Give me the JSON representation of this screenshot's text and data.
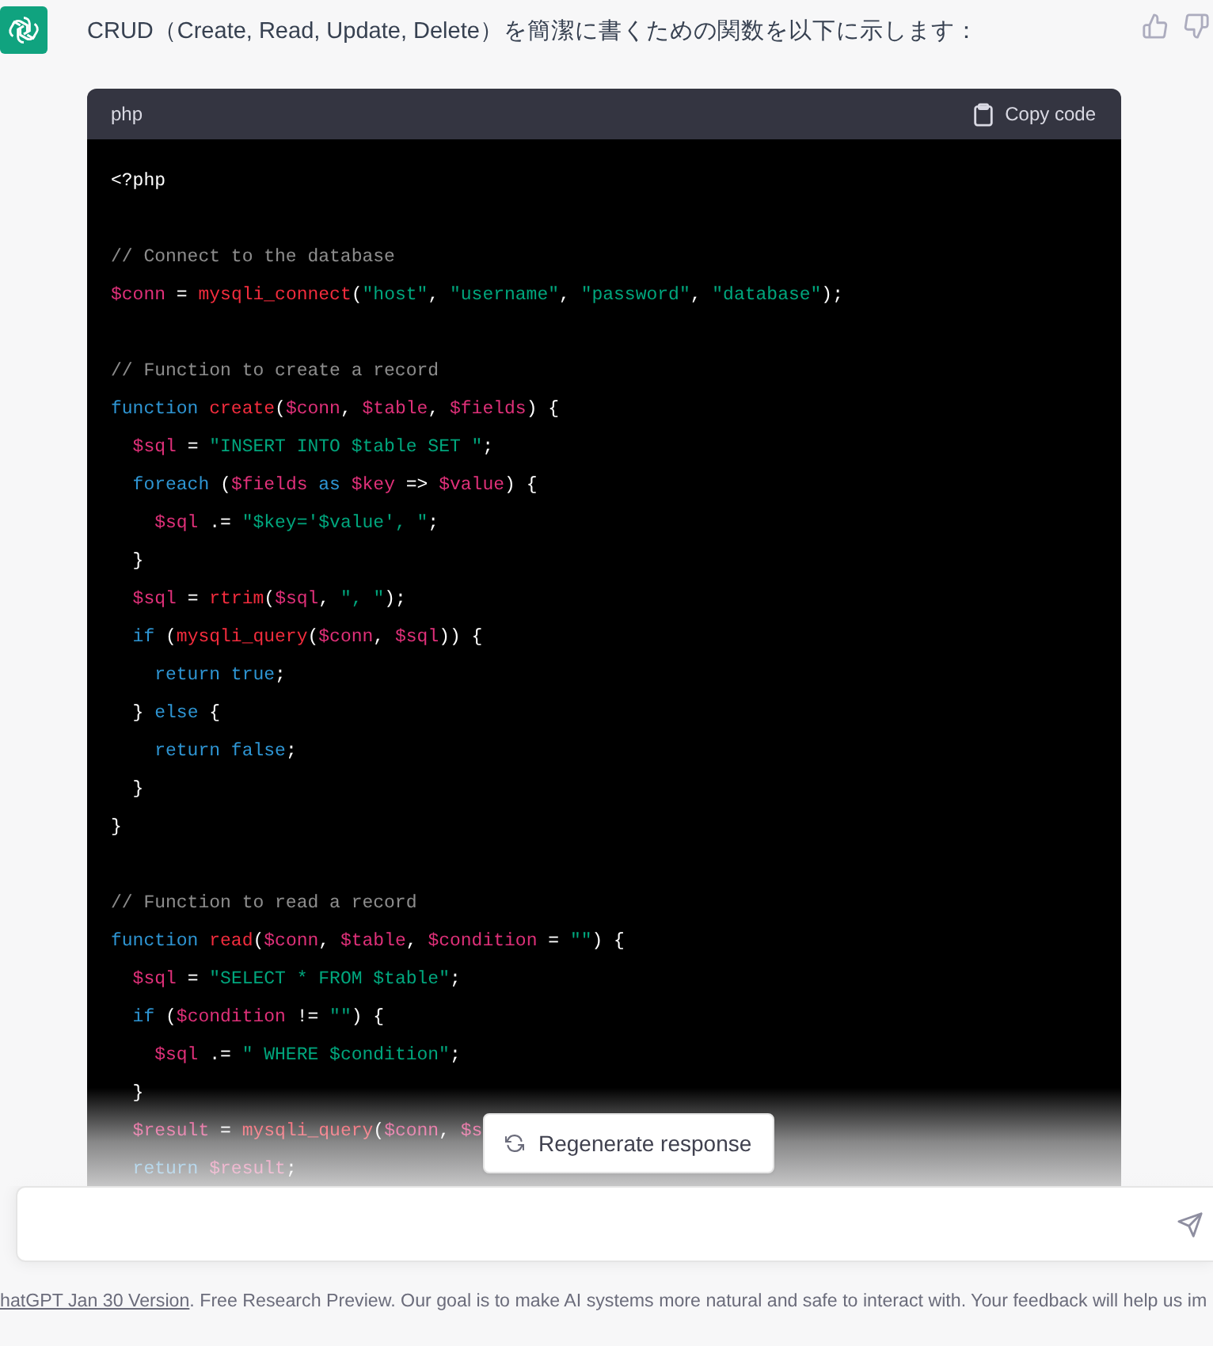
{
  "message": {
    "text": "CRUD（Create, Read, Update, Delete）を簡潔に書くための関数を以下に示します："
  },
  "code_block": {
    "language": "php",
    "copy_label": "Copy code",
    "lines": [
      {
        "kind": "code",
        "tokens": [
          {
            "kind": "plain",
            "text": "<?php"
          }
        ]
      },
      {
        "kind": "blank"
      },
      {
        "kind": "code",
        "tokens": [
          {
            "kind": "comment",
            "text": "// Connect to the database"
          }
        ]
      },
      {
        "kind": "code",
        "tokens": [
          {
            "kind": "var",
            "text": "$conn"
          },
          {
            "kind": "plain",
            "text": " = "
          },
          {
            "kind": "func",
            "text": "mysqli_connect"
          },
          {
            "kind": "plain",
            "text": "("
          },
          {
            "kind": "string",
            "text": "\"host\""
          },
          {
            "kind": "plain",
            "text": ", "
          },
          {
            "kind": "string",
            "text": "\"username\""
          },
          {
            "kind": "plain",
            "text": ", "
          },
          {
            "kind": "string",
            "text": "\"password\""
          },
          {
            "kind": "plain",
            "text": ", "
          },
          {
            "kind": "string",
            "text": "\"database\""
          },
          {
            "kind": "plain",
            "text": ");"
          }
        ]
      },
      {
        "kind": "blank"
      },
      {
        "kind": "code",
        "tokens": [
          {
            "kind": "comment",
            "text": "// Function to create a record"
          }
        ]
      },
      {
        "kind": "code",
        "tokens": [
          {
            "kind": "keyword",
            "text": "function"
          },
          {
            "kind": "func",
            "text": " create"
          },
          {
            "kind": "plain",
            "text": "("
          },
          {
            "kind": "var",
            "text": "$conn"
          },
          {
            "kind": "plain",
            "text": ", "
          },
          {
            "kind": "var",
            "text": "$table"
          },
          {
            "kind": "plain",
            "text": ", "
          },
          {
            "kind": "var",
            "text": "$fields"
          },
          {
            "kind": "plain",
            "text": ") {"
          }
        ]
      },
      {
        "kind": "code",
        "tokens": [
          {
            "kind": "var",
            "text": "  $sql"
          },
          {
            "kind": "plain",
            "text": " = "
          },
          {
            "kind": "string",
            "text": "\"INSERT INTO $table SET \""
          },
          {
            "kind": "plain",
            "text": ";"
          }
        ]
      },
      {
        "kind": "code",
        "tokens": [
          {
            "kind": "keyword",
            "text": "  foreach"
          },
          {
            "kind": "plain",
            "text": " ("
          },
          {
            "kind": "var",
            "text": "$fields"
          },
          {
            "kind": "keyword",
            "text": " as"
          },
          {
            "kind": "var",
            "text": " $key"
          },
          {
            "kind": "plain",
            "text": " => "
          },
          {
            "kind": "var",
            "text": "$value"
          },
          {
            "kind": "plain",
            "text": ") {"
          }
        ]
      },
      {
        "kind": "code",
        "tokens": [
          {
            "kind": "var",
            "text": "    $sql"
          },
          {
            "kind": "plain",
            "text": " .= "
          },
          {
            "kind": "string",
            "text": "\"$key='$value', \""
          },
          {
            "kind": "plain",
            "text": ";"
          }
        ]
      },
      {
        "kind": "code",
        "tokens": [
          {
            "kind": "plain",
            "text": "  }"
          }
        ]
      },
      {
        "kind": "code",
        "tokens": [
          {
            "kind": "var",
            "text": "  $sql"
          },
          {
            "kind": "plain",
            "text": " = "
          },
          {
            "kind": "func",
            "text": "rtrim"
          },
          {
            "kind": "plain",
            "text": "("
          },
          {
            "kind": "var",
            "text": "$sql"
          },
          {
            "kind": "plain",
            "text": ", "
          },
          {
            "kind": "string",
            "text": "\", \""
          },
          {
            "kind": "plain",
            "text": ");"
          }
        ]
      },
      {
        "kind": "code",
        "tokens": [
          {
            "kind": "keyword",
            "text": "  if"
          },
          {
            "kind": "plain",
            "text": " ("
          },
          {
            "kind": "func",
            "text": "mysqli_query"
          },
          {
            "kind": "plain",
            "text": "("
          },
          {
            "kind": "var",
            "text": "$conn"
          },
          {
            "kind": "plain",
            "text": ", "
          },
          {
            "kind": "var",
            "text": "$sql"
          },
          {
            "kind": "plain",
            "text": ")) {"
          }
        ]
      },
      {
        "kind": "code",
        "tokens": [
          {
            "kind": "keyword",
            "text": "    return"
          },
          {
            "kind": "keyword",
            "text": " true"
          },
          {
            "kind": "plain",
            "text": ";"
          }
        ]
      },
      {
        "kind": "code",
        "tokens": [
          {
            "kind": "plain",
            "text": "  } "
          },
          {
            "kind": "keyword",
            "text": "else"
          },
          {
            "kind": "plain",
            "text": " {"
          }
        ]
      },
      {
        "kind": "code",
        "tokens": [
          {
            "kind": "keyword",
            "text": "    return"
          },
          {
            "kind": "keyword",
            "text": " false"
          },
          {
            "kind": "plain",
            "text": ";"
          }
        ]
      },
      {
        "kind": "code",
        "tokens": [
          {
            "kind": "plain",
            "text": "  }"
          }
        ]
      },
      {
        "kind": "code",
        "tokens": [
          {
            "kind": "plain",
            "text": "}"
          }
        ]
      },
      {
        "kind": "blank"
      },
      {
        "kind": "code",
        "tokens": [
          {
            "kind": "comment",
            "text": "// Function to read a record"
          }
        ]
      },
      {
        "kind": "code",
        "tokens": [
          {
            "kind": "keyword",
            "text": "function"
          },
          {
            "kind": "func",
            "text": " read"
          },
          {
            "kind": "plain",
            "text": "("
          },
          {
            "kind": "var",
            "text": "$conn"
          },
          {
            "kind": "plain",
            "text": ", "
          },
          {
            "kind": "var",
            "text": "$table"
          },
          {
            "kind": "plain",
            "text": ", "
          },
          {
            "kind": "var",
            "text": "$condition"
          },
          {
            "kind": "plain",
            "text": " = "
          },
          {
            "kind": "string",
            "text": "\"\""
          },
          {
            "kind": "plain",
            "text": ") {"
          }
        ]
      },
      {
        "kind": "code",
        "tokens": [
          {
            "kind": "var",
            "text": "  $sql"
          },
          {
            "kind": "plain",
            "text": " = "
          },
          {
            "kind": "string",
            "text": "\"SELECT * FROM $table\""
          },
          {
            "kind": "plain",
            "text": ";"
          }
        ]
      },
      {
        "kind": "code",
        "tokens": [
          {
            "kind": "keyword",
            "text": "  if"
          },
          {
            "kind": "plain",
            "text": " ("
          },
          {
            "kind": "var",
            "text": "$condition"
          },
          {
            "kind": "plain",
            "text": " != "
          },
          {
            "kind": "string",
            "text": "\"\""
          },
          {
            "kind": "plain",
            "text": ") {"
          }
        ]
      },
      {
        "kind": "code",
        "tokens": [
          {
            "kind": "var",
            "text": "    $sql"
          },
          {
            "kind": "plain",
            "text": " .= "
          },
          {
            "kind": "string",
            "text": "\" WHERE $condition\""
          },
          {
            "kind": "plain",
            "text": ";"
          }
        ]
      },
      {
        "kind": "code",
        "tokens": [
          {
            "kind": "plain",
            "text": "  }"
          }
        ]
      },
      {
        "kind": "code",
        "tokens": [
          {
            "kind": "var",
            "text": "  $result"
          },
          {
            "kind": "plain",
            "text": " = "
          },
          {
            "kind": "func",
            "text": "mysqli_query"
          },
          {
            "kind": "plain",
            "text": "("
          },
          {
            "kind": "var",
            "text": "$conn"
          },
          {
            "kind": "plain",
            "text": ", "
          },
          {
            "kind": "var",
            "text": "$s"
          }
        ]
      },
      {
        "kind": "code",
        "tokens": [
          {
            "kind": "keyword",
            "text": "  return"
          },
          {
            "kind": "var",
            "text": " $result"
          },
          {
            "kind": "plain",
            "text": ";"
          }
        ]
      }
    ]
  },
  "regenerate_button": {
    "label": "Regenerate response"
  },
  "footer": {
    "link": "hatGPT Jan 30 Version",
    "text": ". Free Research Preview. Our goal is to make AI systems more natural and safe to interact with. Your feedback will help us im"
  }
}
